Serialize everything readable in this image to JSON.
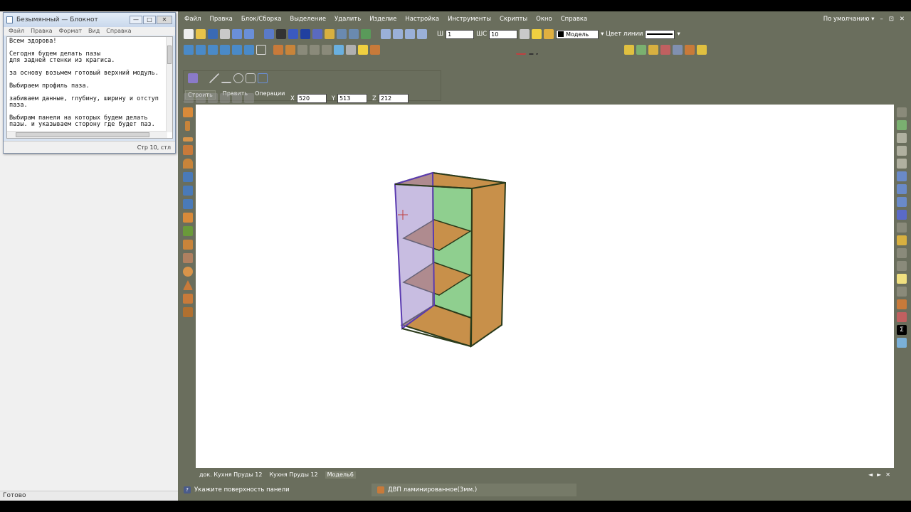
{
  "notepad": {
    "title": "Безымянный — Блокнот",
    "menu": [
      "Файл",
      "Правка",
      "Формат",
      "Вид",
      "Справка"
    ],
    "text": "Всем здорова!\n\nСегодня будем делать пазы\nдля задней стенки из крагиса.\n\nза основу возьмем готовый верхний модуль.\n\nВыбираем профиль паза.\n\nзабиваем данные, глубину, ширину и отступ\nпаза.\n\nВыбирам панели на которых будем делать\nпазы. и указываем сторону где будет паз.",
    "status": "Стр 10, стл",
    "buttons": {
      "minimize": "—",
      "maximize": "□",
      "close": "✕"
    }
  },
  "desktop_status": "Готово",
  "app": {
    "menu": [
      "Файл",
      "Правка",
      "Блок/Сборка",
      "Выделение",
      "Удалить",
      "Изделие",
      "Настройка",
      "Инструменты",
      "Скрипты",
      "Окно",
      "Справка"
    ],
    "preset": "По умолчанию",
    "window_buttons": [
      "–",
      "⊡",
      "✕"
    ],
    "toolbar": {
      "w_label": "Ш",
      "w_value": "1",
      "wc_label": "ШС",
      "wc_value": "10",
      "layer_value": "Модель",
      "line_color_label": "Цвет линии"
    },
    "tool_tabs": [
      "Строить",
      "Править",
      "Операции"
    ],
    "coords": {
      "x_label": "X",
      "x": "520",
      "y_label": "Y",
      "y": "513",
      "z_label": "Z",
      "z": "212"
    },
    "doc_tabs": [
      "док. Кухня Пруды 12",
      "Кухня Пруды 12",
      "Модель6"
    ],
    "doc_nav": [
      "◄",
      "►",
      "✕"
    ],
    "status_hint": "Укажите поверхность панели",
    "status_material": "ДВП ламинированное(3мм.)",
    "help_icon_glyph": "?"
  },
  "colors": {
    "workspace": "#6a6e5d",
    "panel_wood": "#c8904a",
    "glass_green": "#8fcf8f",
    "selection_purple": "#9a86c8",
    "edge_dark": "#2a3a1a"
  }
}
